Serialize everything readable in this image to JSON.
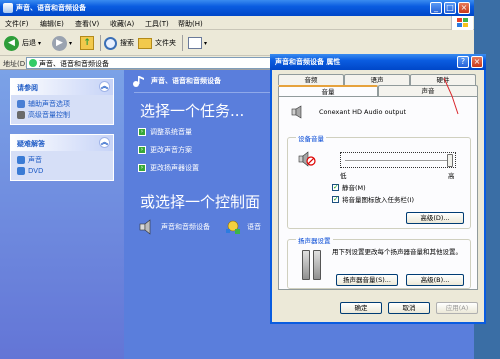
{
  "explorer": {
    "title": "声音、语音和音频设备",
    "menu": [
      "文件(F)",
      "编辑(E)",
      "查看(V)",
      "收藏(A)",
      "工具(T)",
      "帮助(H)"
    ],
    "toolbar": {
      "back": "后退",
      "search": "搜索",
      "folders": "文件夹"
    },
    "address": {
      "label": "地址(D)",
      "value": "声音、语音和音频设备"
    }
  },
  "taskpane": {
    "see_also": {
      "title": "请参阅",
      "items": [
        "辅助声音选项",
        "高级音量控制"
      ]
    },
    "troubleshoot": {
      "title": "疑难解答",
      "items": [
        "声音",
        "DVD"
      ]
    }
  },
  "content": {
    "header": "声音、语音和音频设备",
    "pick_task": "选择一个任务...",
    "tasks": [
      "调整系统音量",
      "更改声音方案",
      "更改扬声器设置"
    ],
    "pick_panel": "或选择一个控制面",
    "icons": [
      "声音和音频设备",
      "语音"
    ]
  },
  "dialog": {
    "title": "声音和音频设备 属性",
    "tabs_back": [
      "音频",
      "语声",
      "硬件"
    ],
    "tabs_front": [
      "音量",
      "声音"
    ],
    "device": "Conexant HD Audio output",
    "volume_group": {
      "title": "设备音量",
      "low": "低",
      "high": "高",
      "mute": "静音(M)",
      "tray": "将音量图标放入任务栏(I)",
      "advanced": "高级(D)..."
    },
    "speaker_group": {
      "title": "扬声器设置",
      "desc": "用下列设置更改每个扬声器音量和其他设置。",
      "speaker_volume": "扬声器音量(S)...",
      "advanced": "高级(B)..."
    },
    "buttons": {
      "ok": "确定",
      "cancel": "取消",
      "apply": "应用(A)"
    }
  },
  "colors": {
    "title_blue": "#0a5ce0",
    "content_blue": "#5a7edc",
    "taskpane_blue": "#7ba2e7",
    "annotation_red": "#d9262c"
  }
}
